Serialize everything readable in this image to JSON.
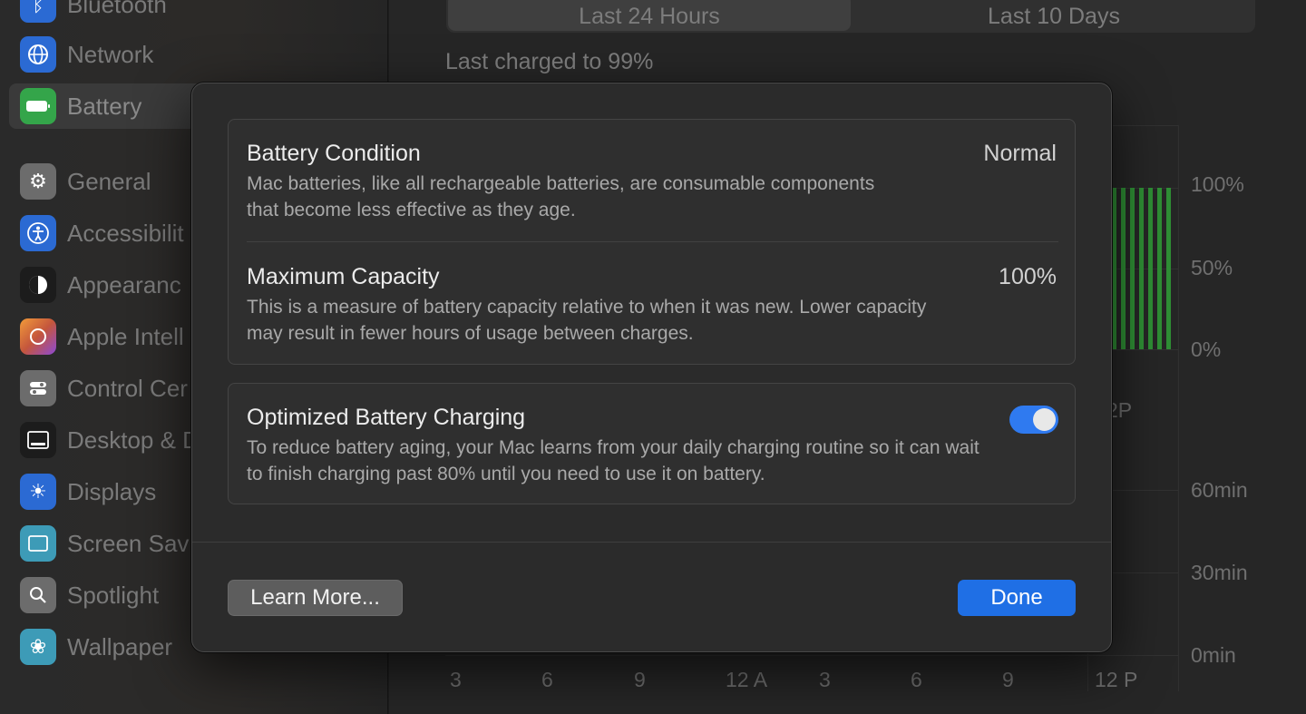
{
  "sidebar": {
    "items": [
      {
        "label": "Bluetooth",
        "icon": "bluetooth-icon",
        "color": "#2b6ad3"
      },
      {
        "label": "Network",
        "icon": "globe-icon",
        "color": "#2b6ad3"
      },
      {
        "label": "Battery",
        "icon": "battery-icon",
        "color": "#34a54a"
      },
      {
        "label": "General",
        "icon": "gear-icon",
        "color": "#6c6c6c"
      },
      {
        "label": "Accessibilit",
        "icon": "accessibility-icon",
        "color": "#2b6ad3"
      },
      {
        "label": "Appearanc",
        "icon": "appearance-icon",
        "color": "#1c1c1c"
      },
      {
        "label": "Apple Intell",
        "icon": "apple-intelligence-icon",
        "color": "#c4563c"
      },
      {
        "label": "Control Cer",
        "icon": "control-center-icon",
        "color": "#6c6c6c"
      },
      {
        "label": "Desktop & D",
        "icon": "desktop-dock-icon",
        "color": "#1c1c1c"
      },
      {
        "label": "Displays",
        "icon": "displays-icon",
        "color": "#2b6ad3"
      },
      {
        "label": "Screen Sav",
        "icon": "screen-saver-icon",
        "color": "#3d9bb7"
      },
      {
        "label": "Spotlight",
        "icon": "spotlight-icon",
        "color": "#6c6c6c"
      },
      {
        "label": "Wallpaper",
        "icon": "wallpaper-icon",
        "color": "#3d9bb7"
      }
    ]
  },
  "main": {
    "tabs": [
      {
        "label": "Last 24 Hours"
      },
      {
        "label": "Last 10 Days"
      }
    ],
    "last_charged": "Last charged to 99%",
    "level_axis": [
      "100%",
      "50%",
      "0%"
    ],
    "level_time_label": "2P",
    "usage_axis": [
      "60min",
      "30min",
      "0min"
    ],
    "time_ticks": [
      "3",
      "6",
      "9",
      "12 A",
      "3",
      "6",
      "9",
      "12 P"
    ]
  },
  "sheet": {
    "condition": {
      "title": "Battery Condition",
      "value": "Normal",
      "description": "Mac batteries, like all rechargeable batteries, are consumable components that become less effective as they age."
    },
    "capacity": {
      "title": "Maximum Capacity",
      "value": "100%",
      "description": "This is a measure of battery capacity relative to when it was new. Lower capacity may result in fewer hours of usage between charges."
    },
    "optimized": {
      "title": "Optimized Battery Charging",
      "enabled": true,
      "description": "To reduce battery aging, your Mac learns from your daily charging routine so it can wait to finish charging past 80% until you need to use it on battery."
    },
    "learn_more_label": "Learn More...",
    "done_label": "Done"
  },
  "colors": {
    "accent": "#1f6fe5",
    "toggle_on": "#2f7af0",
    "battery_green": "#2f8f35"
  }
}
